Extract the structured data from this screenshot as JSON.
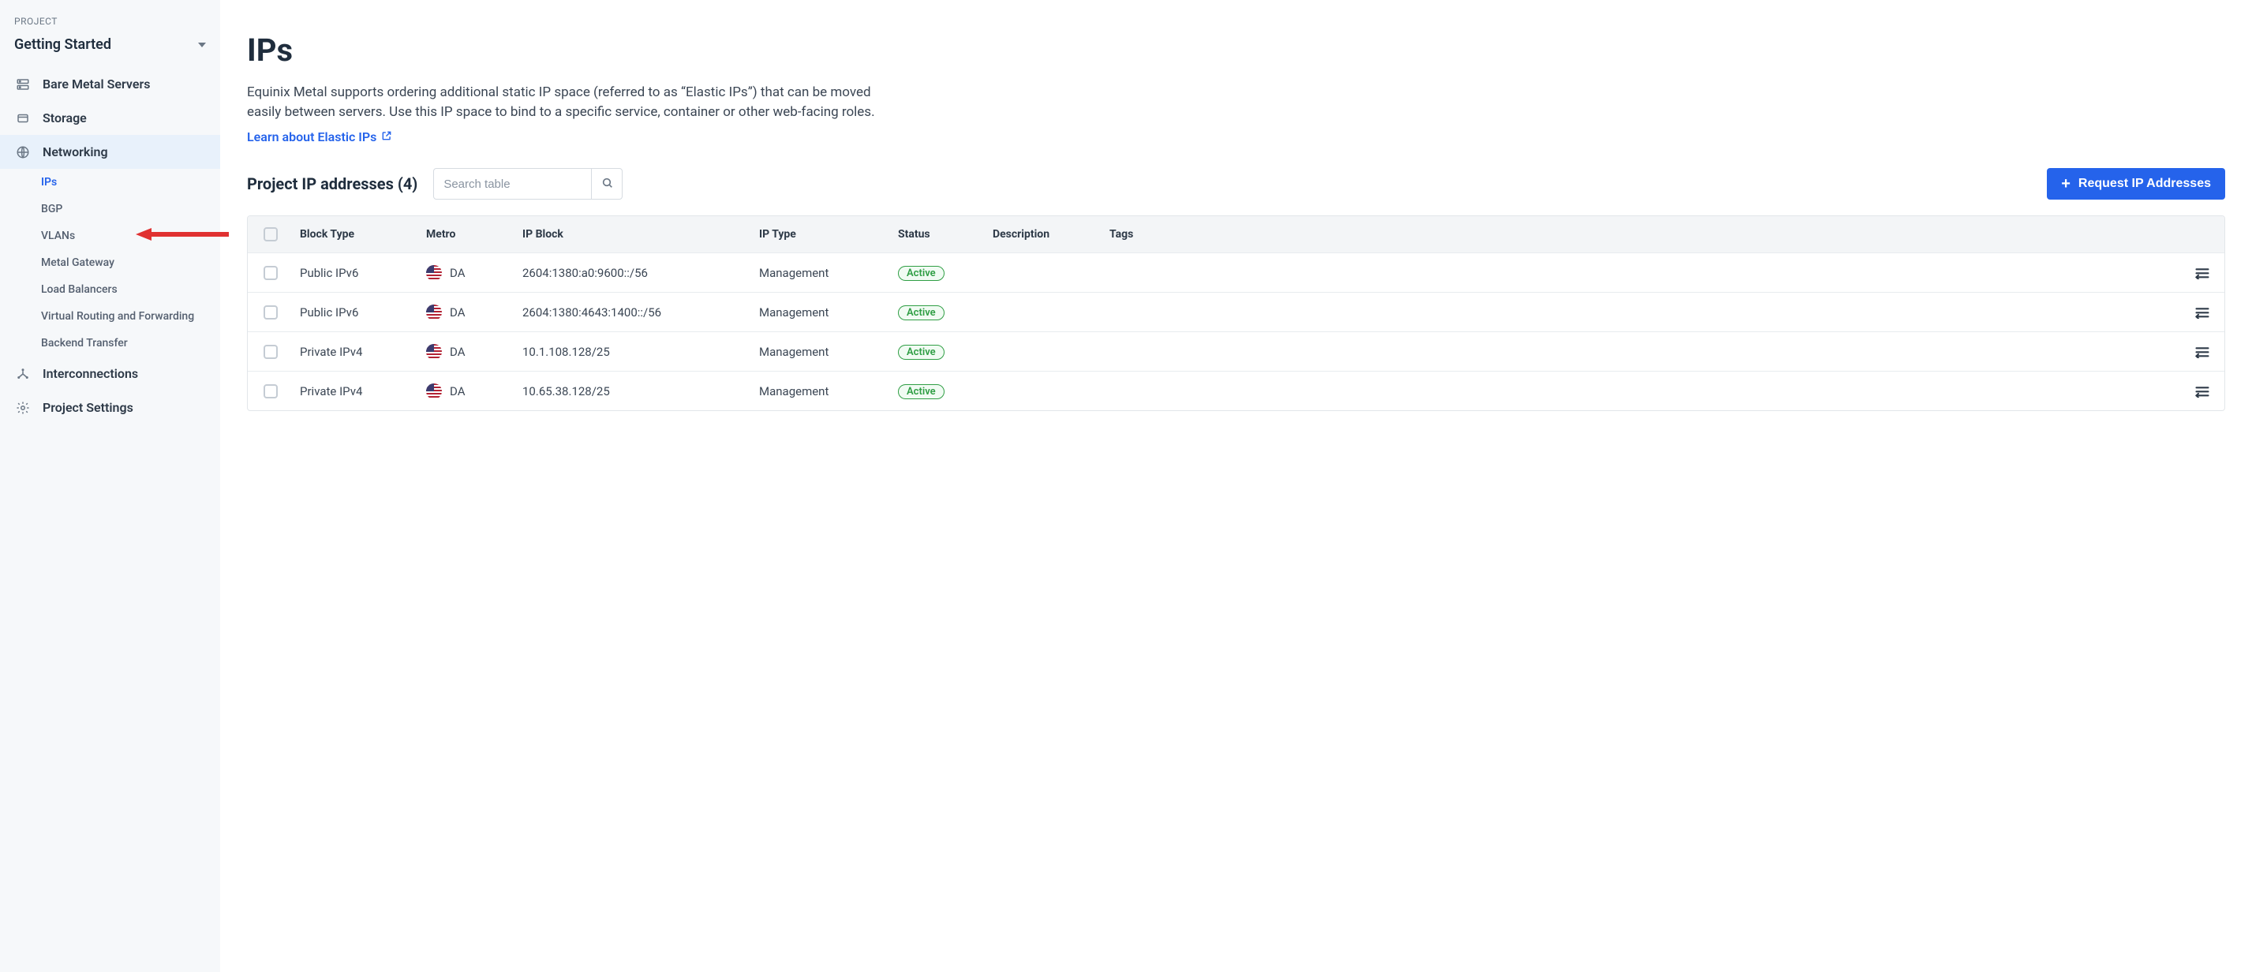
{
  "sidebar": {
    "project_label": "PROJECT",
    "project_name": "Getting Started",
    "nav": {
      "servers": "Bare Metal Servers",
      "storage": "Storage",
      "networking": "Networking",
      "interconnections": "Interconnections",
      "project_settings": "Project Settings"
    },
    "networking_sub": {
      "ips": "IPs",
      "bgp": "BGP",
      "vlans": "VLANs",
      "metal_gateway": "Metal Gateway",
      "load_balancers": "Load Balancers",
      "vrf": "Virtual Routing and Forwarding",
      "backend_transfer": "Backend Transfer"
    }
  },
  "page": {
    "title": "IPs",
    "description": "Equinix Metal supports ordering additional static IP space (referred to as “Elastic IPs”) that can be moved easily between servers. Use this IP space to bind to a specific service, container or other web-facing roles.",
    "learn_link": "Learn about Elastic IPs"
  },
  "toolbar": {
    "heading": "Project IP addresses (4)",
    "search_placeholder": "Search table",
    "request_button": "Request IP Addresses"
  },
  "table": {
    "headers": {
      "block_type": "Block Type",
      "metro": "Metro",
      "ip_block": "IP Block",
      "ip_type": "IP Type",
      "status": "Status",
      "description": "Description",
      "tags": "Tags"
    },
    "rows": [
      {
        "block_type": "Public IPv6",
        "metro": "DA",
        "ip_block": "2604:1380:a0:9600::/56",
        "ip_type": "Management",
        "status": "Active",
        "description": "",
        "tags": ""
      },
      {
        "block_type": "Public IPv6",
        "metro": "DA",
        "ip_block": "2604:1380:4643:1400::/56",
        "ip_type": "Management",
        "status": "Active",
        "description": "",
        "tags": ""
      },
      {
        "block_type": "Private IPv4",
        "metro": "DA",
        "ip_block": "10.1.108.128/25",
        "ip_type": "Management",
        "status": "Active",
        "description": "",
        "tags": ""
      },
      {
        "block_type": "Private IPv4",
        "metro": "DA",
        "ip_block": "10.65.38.128/25",
        "ip_type": "Management",
        "status": "Active",
        "description": "",
        "tags": ""
      }
    ]
  }
}
